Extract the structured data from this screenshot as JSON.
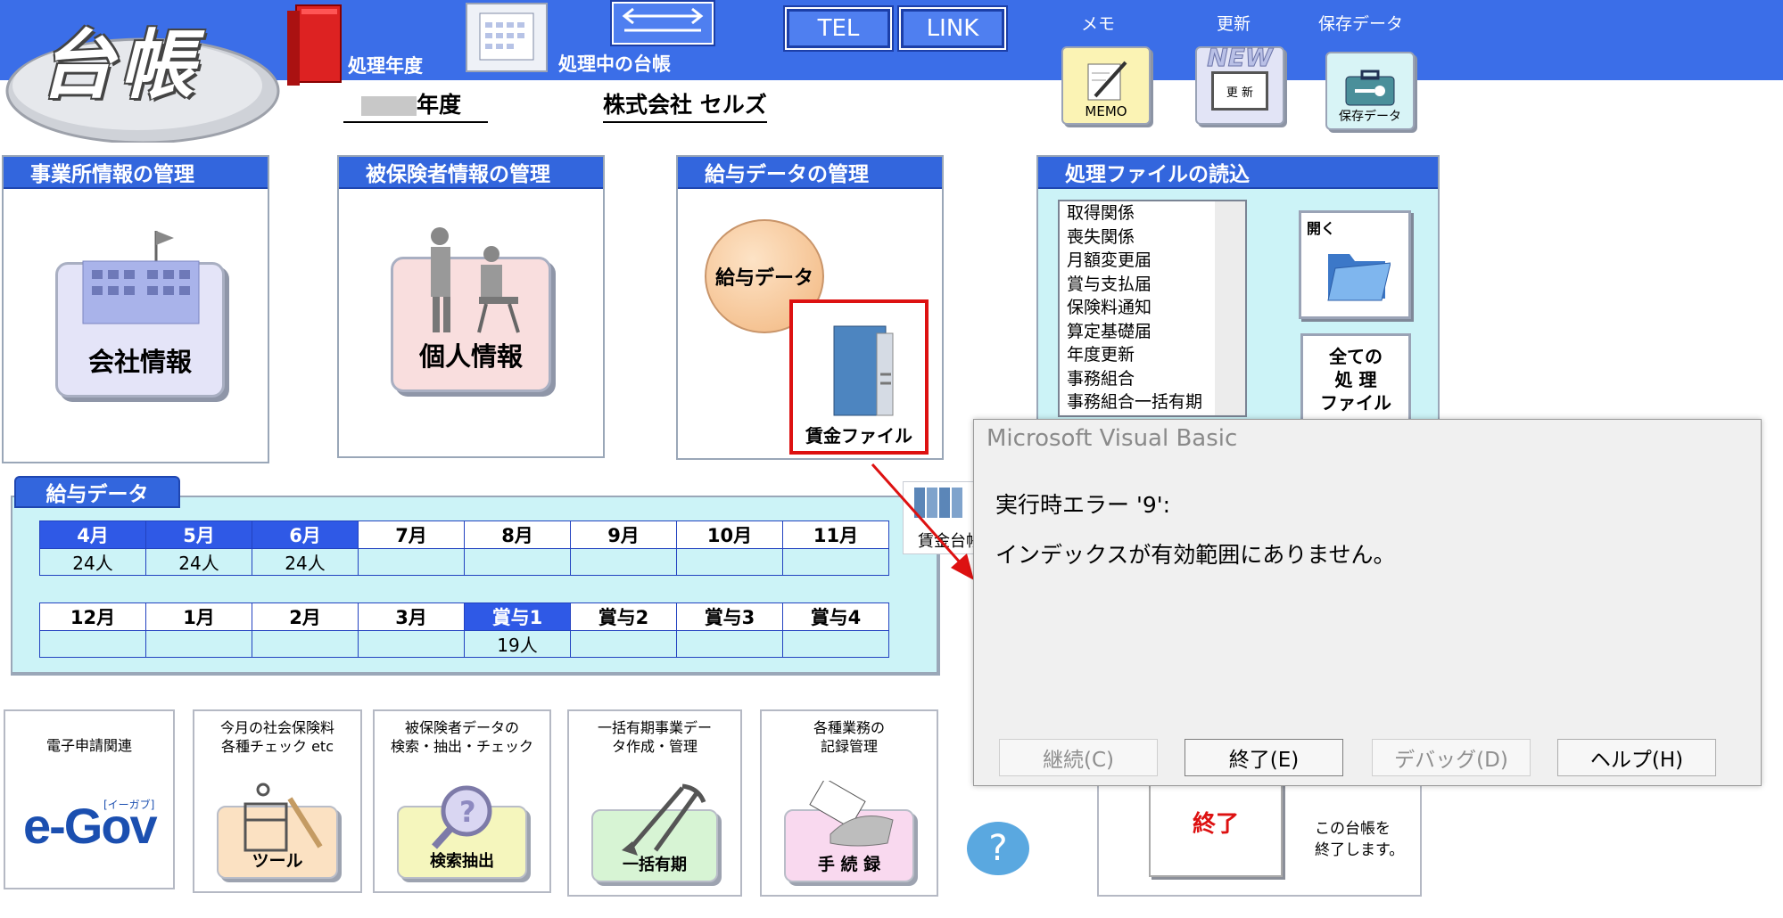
{
  "header": {
    "app_logo_text": "台帳",
    "fiscal_year_label": "処理年度",
    "current_ledger_label": "処理中の台帳",
    "fiscal_year_suffix": "年度",
    "company_name": "株式会社  セルズ",
    "tel_button": "TEL",
    "link_button": "LINK",
    "memo_label": "メモ",
    "memo_icon_caption": "MEMO",
    "update_label": "更新",
    "update_icon_top": "NEW",
    "update_icon_caption": "更 新",
    "saved_data_label": "保存データ",
    "saved_data_icon_caption": "保存データ"
  },
  "panels": {
    "office": {
      "title": "事業所情報の管理",
      "button": "会社情報"
    },
    "insured": {
      "title": "被保険者情報の管理",
      "button": "個人情報"
    },
    "salary": {
      "title": "給与データの管理",
      "button": "給与データ",
      "wage_file_label": "賃金ファイル"
    },
    "files": {
      "title": "処理ファイルの読込",
      "items": [
        "取得関係",
        "喪失関係",
        "月額変更届",
        "賞与支払届",
        "保険料通知",
        "算定基礎届",
        "年度更新",
        "事務組合",
        "事務組合一括有期"
      ],
      "open_label": "開く",
      "all_files_label": "全ての\n処 理\nファイル"
    }
  },
  "salary_data": {
    "title": "給与データ",
    "row1_headers": [
      "4月",
      "5月",
      "6月",
      "7月",
      "8月",
      "9月",
      "10月",
      "11月"
    ],
    "row1_values": [
      "24人",
      "24人",
      "24人",
      "",
      "",
      "",
      "",
      ""
    ],
    "row2_headers": [
      "12月",
      "1月",
      "2月",
      "3月",
      "賞与1",
      "賞与2",
      "賞与3",
      "賞与4"
    ],
    "row2_values": [
      "",
      "",
      "",
      "",
      "19人",
      "",
      "",
      ""
    ],
    "partial_label": "賃金台帳"
  },
  "bottom_tiles": [
    {
      "title": "電子申請関連",
      "caption": "e-Gov",
      "sub": "[イーガブ]"
    },
    {
      "title": "今月の社会保険料\n各種チェック etc",
      "caption": "ツール"
    },
    {
      "title": "被保険者データの\n検索・抽出・チェック",
      "caption": "検索抽出"
    },
    {
      "title": "一括有期事業デー\nタ作成・管理",
      "caption": "一括有期"
    },
    {
      "title": "各種業務の\n記録管理",
      "caption": "手 続 録"
    }
  ],
  "help_glyph": "?",
  "exit": {
    "button": "終了",
    "description": "この台帳を\n終了します。"
  },
  "dialog": {
    "title": "Microsoft Visual Basic",
    "error_line": "実行時エラー '9':",
    "message": "インデックスが有効範囲にありません。",
    "buttons": {
      "continue": "継続(C)",
      "end": "終了(E)",
      "debug": "デバッグ(D)",
      "help": "ヘルプ(H)"
    }
  },
  "colors": {
    "header_blue": "#3b6ee8",
    "panel_title_blue": "#3366dd",
    "highlight_red": "#dd1111",
    "selected_month": "#2f59e6"
  }
}
